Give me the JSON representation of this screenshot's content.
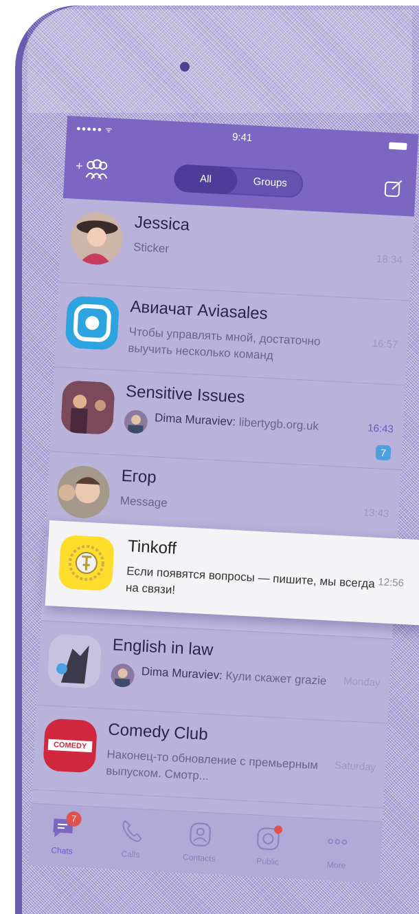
{
  "status": {
    "signal": "●●●●● ᯤ",
    "time": "9:41"
  },
  "header": {
    "tabs": [
      {
        "label": "All"
      },
      {
        "label": "Groups"
      }
    ]
  },
  "chats": [
    {
      "name": "Jessica",
      "message": "Sticker",
      "time": "18:34"
    },
    {
      "name": "Авиачат Aviasales",
      "message": "Чтобы управлять мной, достаточно выучить несколько команд",
      "time": "16:57"
    },
    {
      "name": "Sensitive Issues",
      "sender": "Dima Muraviev:",
      "message": "libertygb.org.uk",
      "time": "16:43",
      "unread": "7"
    },
    {
      "name": "Егор",
      "message": "Message",
      "time": "13:43"
    },
    {
      "name": "English in law",
      "sender": "Dima Muraviev:",
      "message": "Кули скажет grazie",
      "time": "Monday"
    },
    {
      "name": "Comedy Club",
      "message": "Наконец-то обновление с премьерным выпуском. Смотр...",
      "time": "Saturday",
      "logo_text": "COMEDY"
    }
  ],
  "highlighted_chat": {
    "name": "Tinkoff",
    "message": "Если появятся вопросы — пишите, мы всегда на связи!",
    "time": "12:56"
  },
  "tabbar": {
    "items": [
      {
        "label": "Chats",
        "badge": "7"
      },
      {
        "label": "Calls"
      },
      {
        "label": "Contacts"
      },
      {
        "label": "Public"
      },
      {
        "label": "More"
      }
    ]
  },
  "colors": {
    "accent": "#7b67c2",
    "screen": "#b9b2da",
    "unread_badge": "#4f9fde",
    "tab_badge": "#e0534d",
    "tinkoff_yellow": "#ffdd2d"
  }
}
